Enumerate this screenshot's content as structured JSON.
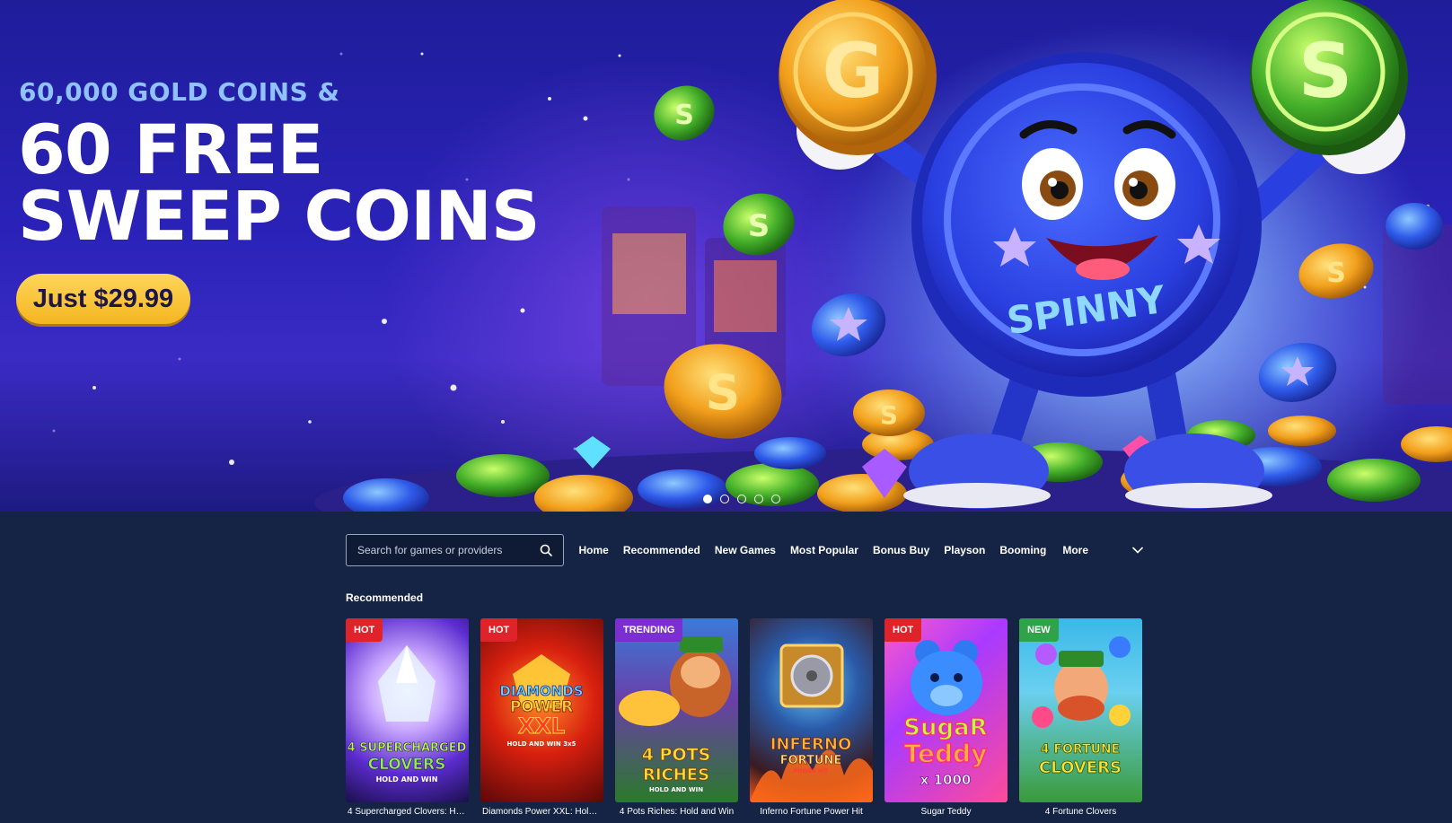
{
  "hero": {
    "subtitle": "60,000 GOLD COINS &",
    "title": "60 FREE\nSWEEP COINS",
    "price_button": "Just $29.99",
    "mascot_label": "SPINNY",
    "coin_letters": [
      "G",
      "S"
    ],
    "carousel": {
      "count": 5,
      "active_index": 0
    }
  },
  "nav": {
    "search_placeholder": "Search for games or providers",
    "links": [
      "Home",
      "Recommended",
      "New Games",
      "Most Popular",
      "Bonus Buy",
      "Playson",
      "Booming"
    ],
    "more_label": "More"
  },
  "recommended": {
    "title": "Recommended",
    "games": [
      {
        "title": "4 Supercharged Clovers: Hol...",
        "badge": "HOT",
        "art_lines": [
          "4 SUPERCHARGED",
          "CLOVERS",
          "HOLD AND WIN"
        ]
      },
      {
        "title": "Diamonds Power XXL: Hold a...",
        "badge": "HOT",
        "art_lines": [
          "DIAMONDS",
          "POWER",
          "XXL",
          "HOLD AND WIN 3x5"
        ]
      },
      {
        "title": "4 Pots Riches: Hold and Win",
        "badge": "TRENDING",
        "art_lines": [
          "4 POTS",
          "RICHES",
          "HOLD AND WIN"
        ]
      },
      {
        "title": "Inferno Fortune Power Hit",
        "badge": "",
        "art_lines": [
          "INFERNO",
          "FORTUNE",
          "POWER HIT"
        ]
      },
      {
        "title": "Sugar Teddy",
        "badge": "HOT",
        "art_lines": [
          "SugaR",
          "Teddy",
          "x 1000"
        ]
      },
      {
        "title": "4 Fortune Clovers",
        "badge": "NEW",
        "art_lines": [
          "4 FORTUNE",
          "CLOVERS"
        ]
      }
    ]
  },
  "colors": {
    "page_bg": "#152444",
    "hot_badge": "#e0222a",
    "trending_badge": "#7b2fd0",
    "new_badge": "#2ea34a",
    "price_button": "#f6bd2a"
  }
}
